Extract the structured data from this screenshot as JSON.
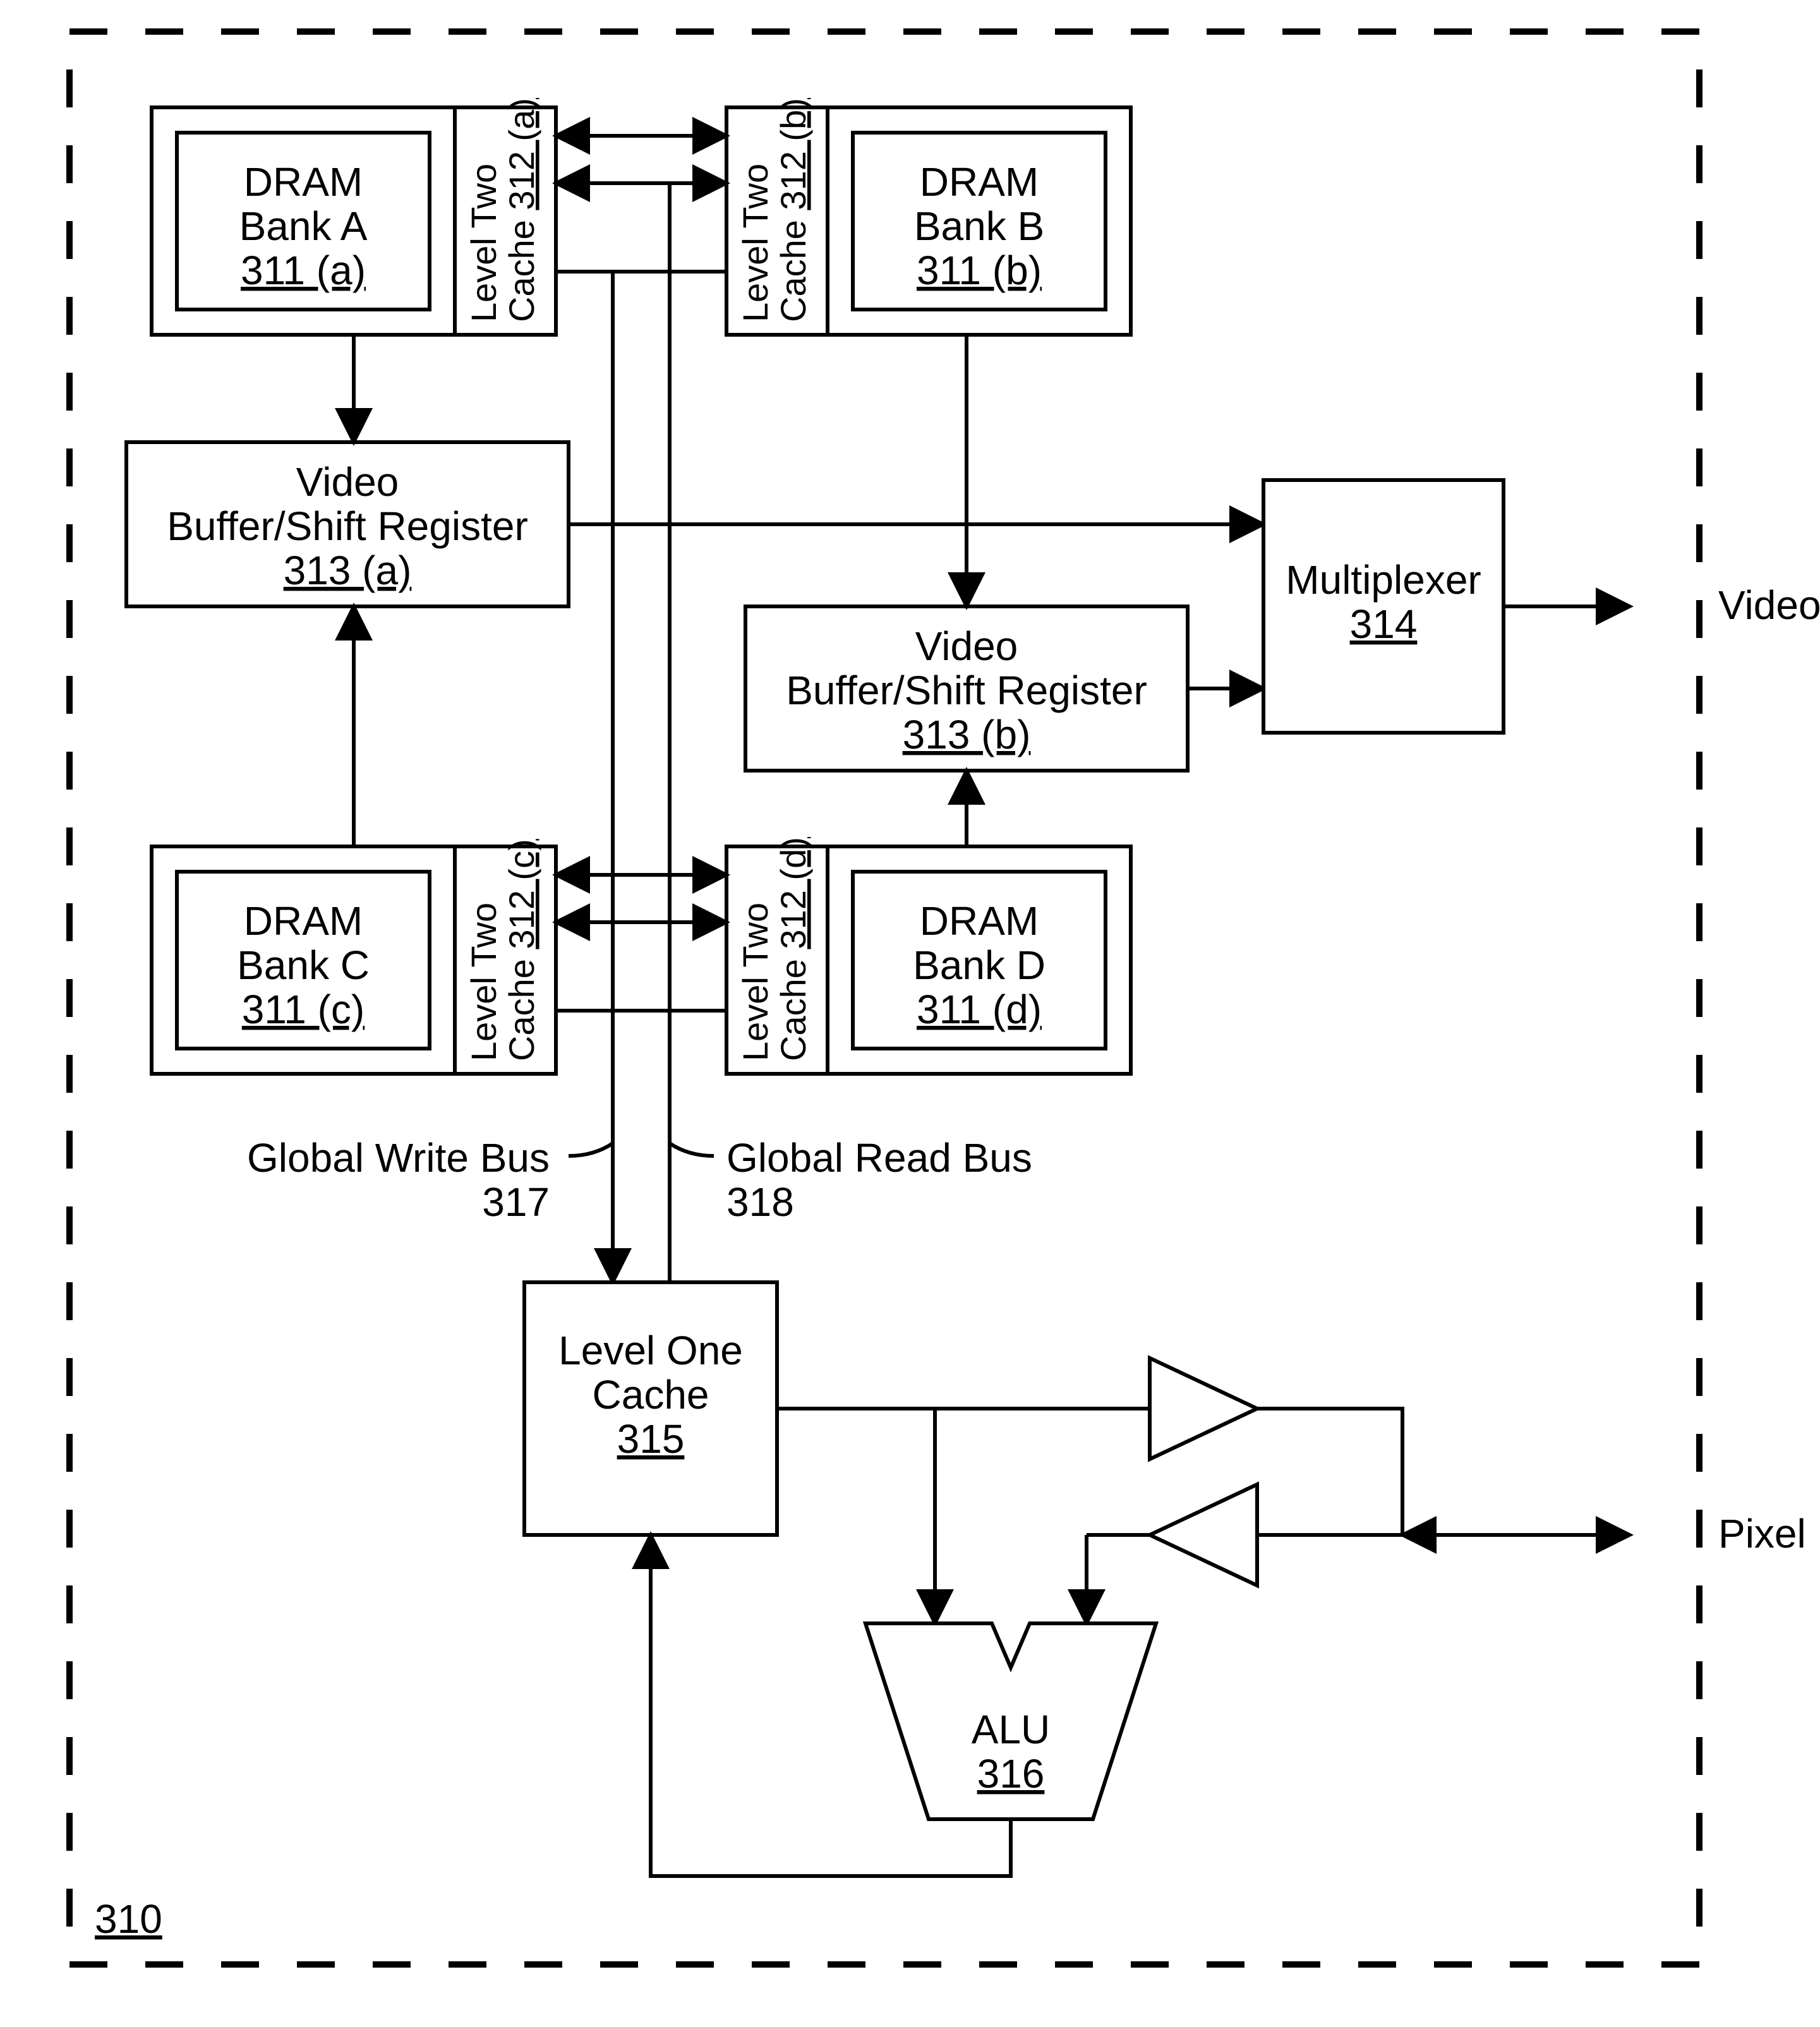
{
  "frame": {
    "ref": "310"
  },
  "blocks": {
    "dram_a": {
      "l1": "DRAM",
      "l2": "Bank A",
      "ref": "311 (a)"
    },
    "dram_b": {
      "l1": "DRAM",
      "l2": "Bank B",
      "ref": "311 (b)"
    },
    "dram_c": {
      "l1": "DRAM",
      "l2": "Bank C",
      "ref": "311 (c)"
    },
    "dram_d": {
      "l1": "DRAM",
      "l2": "Bank D",
      "ref": "311 (d)"
    },
    "l2_a": {
      "l1": "Level Two",
      "l2": "Cache",
      "ref": "312 (a)"
    },
    "l2_b": {
      "l1": "Level Two",
      "l2": "Cache",
      "ref": "312 (b)"
    },
    "l2_c": {
      "l1": "Level Two",
      "l2": "Cache",
      "ref": "312 (c)"
    },
    "l2_d": {
      "l1": "Level Two",
      "l2": "Cache",
      "ref": "312 (d)"
    },
    "vbsr_a": {
      "l1": "Video",
      "l2": "Buffer/Shift Register",
      "ref": "313 (a)"
    },
    "vbsr_b": {
      "l1": "Video",
      "l2": "Buffer/Shift Register",
      "ref": "313 (b)"
    },
    "mux": {
      "l1": "Multiplexer",
      "ref": "314"
    },
    "l1cache": {
      "l1": "Level One",
      "l2": "Cache",
      "ref": "315"
    },
    "alu": {
      "l1": "ALU",
      "ref": "316"
    }
  },
  "buses": {
    "gwb": {
      "l1": "Global Write Bus",
      "ref": "317"
    },
    "grb": {
      "l1": "Global Read Bus",
      "ref": "318"
    }
  },
  "ext": {
    "video": "Video",
    "pixel": "Pixel Data"
  }
}
